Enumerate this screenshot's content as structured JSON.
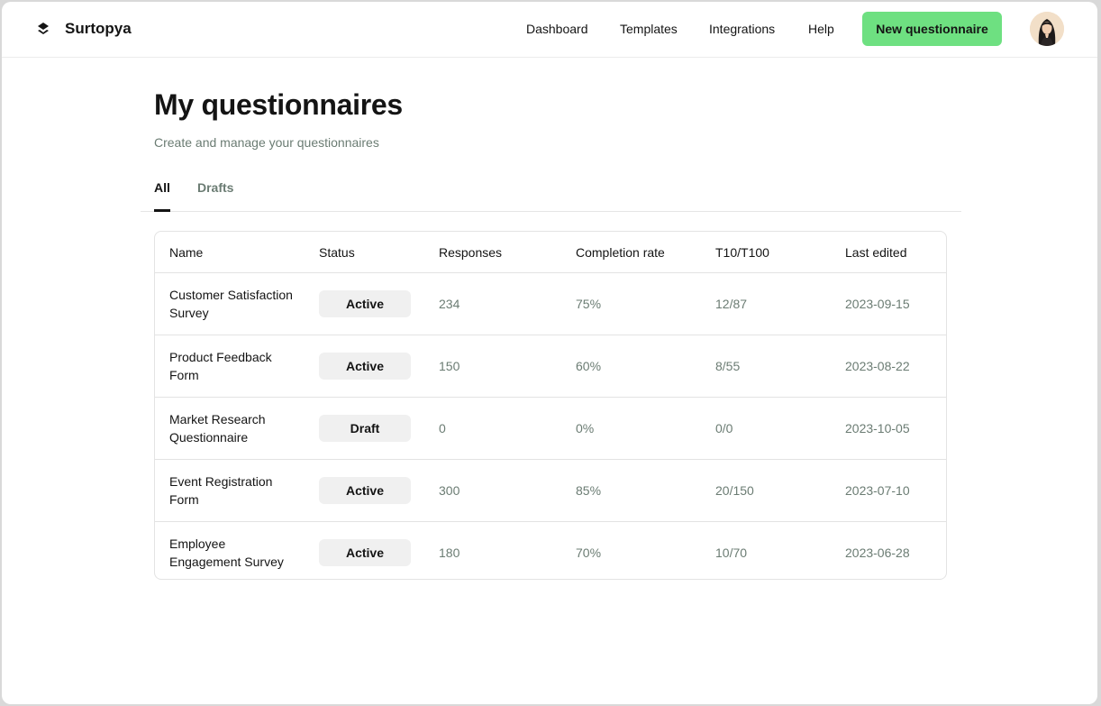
{
  "header": {
    "brand": "Surtopya",
    "nav": [
      "Dashboard",
      "Templates",
      "Integrations",
      "Help"
    ],
    "new_button": "New questionnaire",
    "accent_color": "#6ee081"
  },
  "page": {
    "title": "My questionnaires",
    "subtitle": "Create and manage your questionnaires"
  },
  "tabs": [
    {
      "label": "All",
      "active": true
    },
    {
      "label": "Drafts",
      "active": false
    }
  ],
  "table": {
    "columns": [
      "Name",
      "Status",
      "Responses",
      "Completion rate",
      "T10/T100",
      "Last edited"
    ],
    "rows": [
      {
        "name": "Customer Satisfaction Survey",
        "status": "Active",
        "responses": "234",
        "completion": "75%",
        "t10": "12/87",
        "edited": "2023-09-15"
      },
      {
        "name": "Product Feedback Form",
        "status": "Active",
        "responses": "150",
        "completion": "60%",
        "t10": "8/55",
        "edited": "2023-08-22"
      },
      {
        "name": "Market Research Questionnaire",
        "status": "Draft",
        "responses": "0",
        "completion": "0%",
        "t10": "0/0",
        "edited": "2023-10-05"
      },
      {
        "name": "Event Registration Form",
        "status": "Active",
        "responses": "300",
        "completion": "85%",
        "t10": "20/150",
        "edited": "2023-07-10"
      },
      {
        "name": "Employee Engagement Survey",
        "status": "Active",
        "responses": "180",
        "completion": "70%",
        "t10": "10/70",
        "edited": "2023-06-28"
      }
    ]
  }
}
